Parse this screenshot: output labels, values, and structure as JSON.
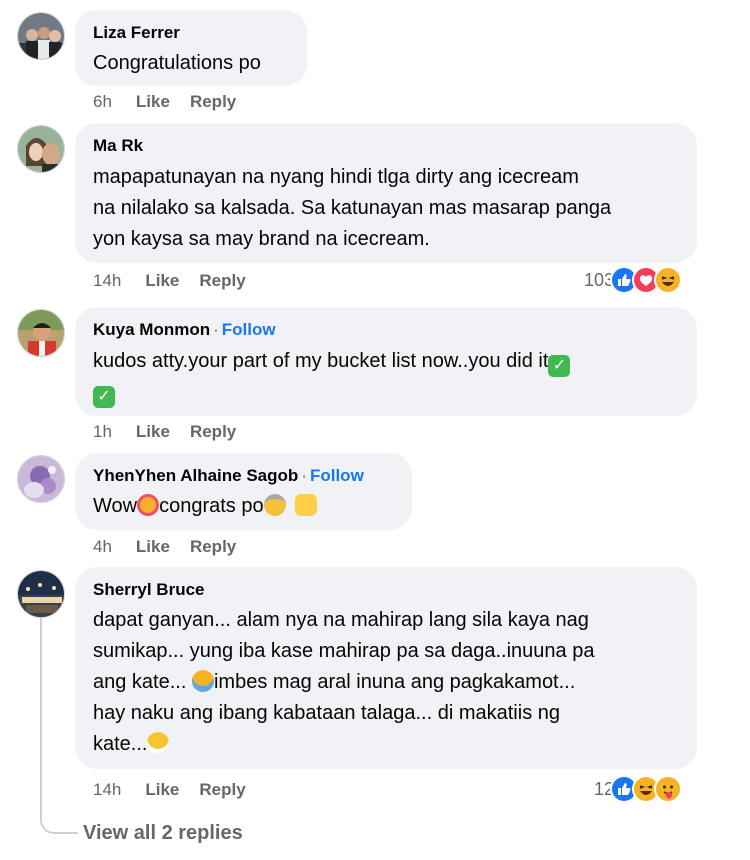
{
  "comments": [
    {
      "name": "Liza Ferrer",
      "follow": "",
      "text": "Congratulations po",
      "time": "6h",
      "like": "Like",
      "reply": "Reply",
      "reaction_count": ""
    },
    {
      "name": "Ma Rk",
      "follow": "",
      "text_lines": [
        "mapapatunayan na nyang hindi tlga dirty ang icecream",
        "na nilalako sa kalsada. Sa katunayan mas masarap panga",
        "yon kaysa sa may brand na icecream."
      ],
      "time": "14h",
      "like": "Like",
      "reply": "Reply",
      "reaction_count": "103",
      "reaction_icons": [
        "like-icon",
        "love-icon",
        "haha-icon"
      ]
    },
    {
      "name": "Kuya Monmon",
      "follow": "Follow",
      "text": "kudos atty.your part of my bucket list now..you did it",
      "time": "1h",
      "like": "Like",
      "reply": "Reply",
      "reaction_count": ""
    },
    {
      "name": "YhenYhen Alhaine Sagob",
      "follow": "Follow",
      "text_parts": [
        "Wow",
        "congrats po"
      ],
      "time": "4h",
      "like": "Like",
      "reply": "Reply",
      "reaction_count": ""
    },
    {
      "name": "Sherryl Bruce",
      "follow": "",
      "text_lines": [
        "dapat ganyan... alam nya na mahirap lang sila kaya nag",
        "sumikap... yung iba kase mahirap pa sa daga..inuuna pa",
        "ang kate... ",
        "imbes mag aral inuna ang pagkakamot...",
        "hay naku ang ibang kabataan talaga... di makatiis ng",
        "kate..."
      ],
      "time": "14h",
      "like": "Like",
      "reply": "Reply",
      "reaction_count": "12",
      "reaction_icons": [
        "like-icon",
        "haha-icon",
        "care-icon"
      ]
    }
  ],
  "view_replies": "View all 2 replies",
  "dot": "·",
  "colors": {
    "bubble": "#f0f2f5",
    "meta": "#65676b",
    "follow": "#1877f2"
  }
}
